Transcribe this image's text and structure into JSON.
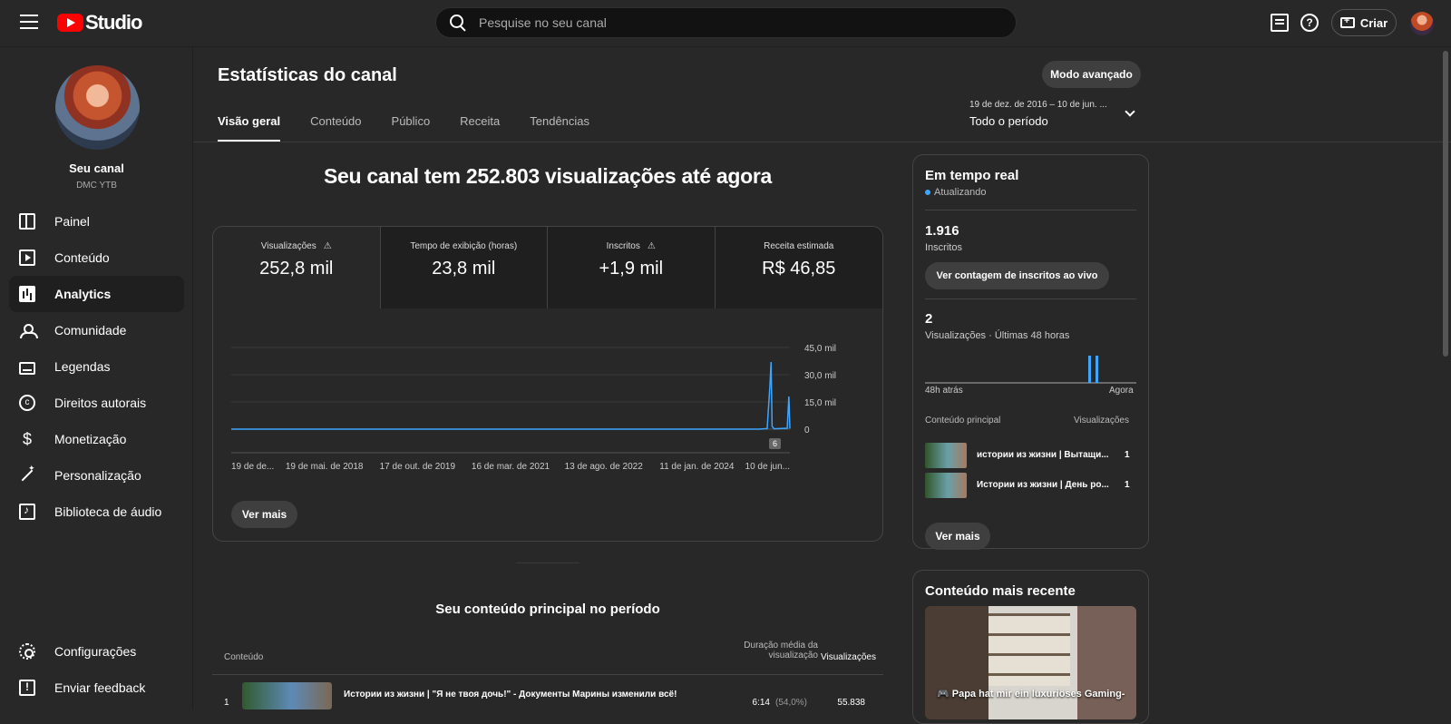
{
  "header": {
    "logo_text": "Studio",
    "search_placeholder": "Pesquise no seu canal",
    "create_label": "Criar",
    "help_icon": "?"
  },
  "sidebar": {
    "channel_name": "Seu canal",
    "channel_handle": "DMC YTB",
    "items": [
      {
        "label": "Painel",
        "icon": "dashboard-icon"
      },
      {
        "label": "Conteúdo",
        "icon": "content-icon"
      },
      {
        "label": "Analytics",
        "icon": "analytics-icon"
      },
      {
        "label": "Comunidade",
        "icon": "community-icon"
      },
      {
        "label": "Legendas",
        "icon": "subtitles-icon"
      },
      {
        "label": "Direitos autorais",
        "icon": "copyright-icon"
      },
      {
        "label": "Monetização",
        "icon": "dollar-icon"
      },
      {
        "label": "Personalização",
        "icon": "wand-icon"
      },
      {
        "label": "Biblioteca de áudio",
        "icon": "audio-library-icon"
      }
    ],
    "bottom_items": [
      {
        "label": "Configurações",
        "icon": "settings-icon"
      },
      {
        "label": "Enviar feedback",
        "icon": "feedback-icon"
      }
    ]
  },
  "main": {
    "title": "Estatísticas do canal",
    "advanced_mode": "Modo avançado",
    "date_range_detail": "19 de dez. de 2016 – 10 de jun. ...",
    "date_range_label": "Todo o período",
    "tabs": [
      "Visão geral",
      "Conteúdo",
      "Público",
      "Receita",
      "Tendências"
    ],
    "headline": "Seu canal tem 252.803 visualizações até agora",
    "metrics": [
      {
        "label": "Visualizações",
        "value": "252,8 mil",
        "warning": "⚠"
      },
      {
        "label": "Tempo de exibição (horas)",
        "value": "23,8 mil"
      },
      {
        "label": "Inscritos",
        "value": "+1,9 mil",
        "warning": "⚠"
      },
      {
        "label": "Receita estimada",
        "value": "R$ 46,85"
      }
    ],
    "chart_note_badge": "6",
    "view_more": "Ver mais",
    "top_content_title": "Seu conteúdo principal no período",
    "table_headers": {
      "content": "Conteúdo",
      "duration_line1": "Duração média da",
      "duration_line2": "visualização",
      "views": "Visualizações"
    },
    "top_rows": [
      {
        "rank": "1",
        "title": "Истории из жизни | \"Я не твоя дочь!\" - Документы Марины изменили всё!",
        "duration": "6:14",
        "percent": "(54,0%)",
        "views": "55.838"
      }
    ]
  },
  "realtime": {
    "title": "Em tempo real",
    "status": "Atualizando",
    "subscribers_value": "1.916",
    "subscribers_label": "Inscritos",
    "live_count_button": "Ver contagem de inscritos ao vivo",
    "views_value": "2",
    "views_label": "Visualizações · Últimas 48 horas",
    "axis_left": "48h atrás",
    "axis_right": "Agora",
    "column_content": "Conteúdo principal",
    "column_views": "Visualizações",
    "rows": [
      {
        "title": "истории из жизни | Вытащи...",
        "views": "1"
      },
      {
        "title": "Истории из жизни | День ро...",
        "views": "1"
      }
    ],
    "view_more": "Ver mais"
  },
  "latest": {
    "title": "Conteúdo mais recente",
    "caption": "🎮 Papa hat mir ein luxuriöses Gaming-"
  },
  "chart_data": [
    {
      "type": "line",
      "title": "",
      "xlabel": "",
      "ylabel": "",
      "x_tick_labels": [
        "19 de de...",
        "19 de mai. de 2018",
        "17 de out. de 2019",
        "16 de mar. de 2021",
        "13 de ago. de 2022",
        "11 de jan. de 2024",
        "10 de jun..."
      ],
      "y_tick_labels": [
        "0",
        "15,0 mil",
        "30,0 mil",
        "45,0 mil"
      ],
      "ylim": [
        0,
        45000
      ],
      "series": [
        {
          "x": [
            "2016-12-19",
            "2018-05-19",
            "2019-10-17",
            "2021-03-16",
            "2022-08-13",
            "2024-01-11",
            "2024-02-20",
            "2024-03-05",
            "2024-03-10",
            "2024-03-15",
            "2024-03-25",
            "2024-05-28",
            "2024-06-05",
            "2024-06-10"
          ],
          "y": [
            0,
            0,
            0,
            0,
            0,
            0,
            300,
            25000,
            37000,
            1500,
            200,
            500,
            18000,
            300
          ]
        }
      ],
      "grid": true,
      "color": "#3ea6ff"
    },
    {
      "type": "bar",
      "title": "",
      "categories": [
        "48h atrás",
        "Agora"
      ],
      "values": [
        1,
        1
      ],
      "color": "#3ea6ff"
    }
  ]
}
